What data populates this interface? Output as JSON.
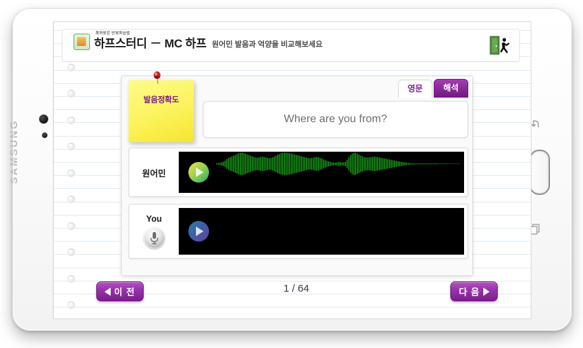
{
  "device": {
    "brand": "SAMSUNG",
    "nav": {
      "back_icon": "back-arrow-icon",
      "home_icon": "home-button",
      "recent_icon": "recent-apps-icon"
    },
    "camera_icon": "front-camera",
    "sensor_icon": "proximity-sensor"
  },
  "header": {
    "brand_icon": "book-app-icon",
    "tagline": "특허받은 반복학습법",
    "title": "하프스터디 － MC 하프",
    "subtitle": "원어민 발음과 억양을 비교해보세요",
    "exit_icon": "exit-door-icon"
  },
  "card": {
    "sticky": {
      "label": "발음정확도",
      "pin_icon": "red-pushpin-icon"
    },
    "tabs": [
      {
        "label": "영문",
        "active": true
      },
      {
        "label": "해석",
        "active": false
      }
    ],
    "sentence": "Where are you from?",
    "rows": [
      {
        "label": "원어민",
        "play_icon": "play-button-green",
        "has_waveform": true,
        "waveform_color": "#18a818"
      },
      {
        "label": "You",
        "mic_icon": "microphone-icon",
        "play_icon": "play-button-blue",
        "has_waveform": false,
        "waveform_color": "#18a818"
      }
    ]
  },
  "bottom_nav": {
    "prev_label": "이 전",
    "prev_icon": "triangle-left-icon",
    "next_label": "다 음",
    "next_icon": "triangle-right-icon",
    "page_counter": "1 / 64"
  },
  "colors": {
    "accent_purple": "#8a2a9a",
    "sticky_yellow": "#fcf35a",
    "wave_green": "#18a818",
    "sentence_gray": "#6d6d6d",
    "rule_blue": "#dfeaf4"
  },
  "waveform": {
    "native_amplitudes": [
      0.06,
      0.08,
      0.1,
      0.14,
      0.2,
      0.3,
      0.42,
      0.52,
      0.6,
      0.66,
      0.72,
      0.8,
      0.88,
      0.94,
      0.98,
      1.0,
      0.96,
      0.9,
      0.84,
      0.78,
      0.72,
      0.66,
      0.62,
      0.58,
      0.56,
      0.58,
      0.62,
      0.64,
      0.62,
      0.58,
      0.54,
      0.5,
      0.52,
      0.58,
      0.66,
      0.74,
      0.82,
      0.88,
      0.94,
      0.97,
      0.99,
      1.0,
      0.98,
      0.95,
      0.92,
      0.88,
      0.84,
      0.8,
      0.76,
      0.72,
      0.68,
      0.64,
      0.6,
      0.56,
      0.52,
      0.5,
      0.52,
      0.56,
      0.6,
      0.62,
      0.6,
      0.55,
      0.48,
      0.4,
      0.33,
      0.27,
      0.22,
      0.18,
      0.15,
      0.13,
      0.12,
      0.14,
      0.18,
      0.16,
      0.13,
      0.15,
      0.2,
      0.36,
      0.58,
      0.78,
      0.92,
      1.0,
      0.97,
      0.9,
      0.82,
      0.74,
      0.68,
      0.62,
      0.58,
      0.56,
      0.58,
      0.6,
      0.62,
      0.64,
      0.62,
      0.6,
      0.57,
      0.54,
      0.51,
      0.48,
      0.45,
      0.42,
      0.39,
      0.36,
      0.33,
      0.3,
      0.27,
      0.24,
      0.21,
      0.18,
      0.15,
      0.13,
      0.11,
      0.09,
      0.07,
      0.06,
      0.05,
      0.05,
      0.04,
      0.04,
      0.04,
      0.04,
      0.04,
      0.04,
      0.04,
      0.04,
      0.04,
      0.04,
      0.04,
      0.04,
      0.04,
      0.03,
      0.03,
      0.03,
      0.03,
      0.03,
      0.03,
      0.02,
      0.02,
      0.02,
      0.02,
      0.02,
      0.02,
      0.02
    ]
  }
}
